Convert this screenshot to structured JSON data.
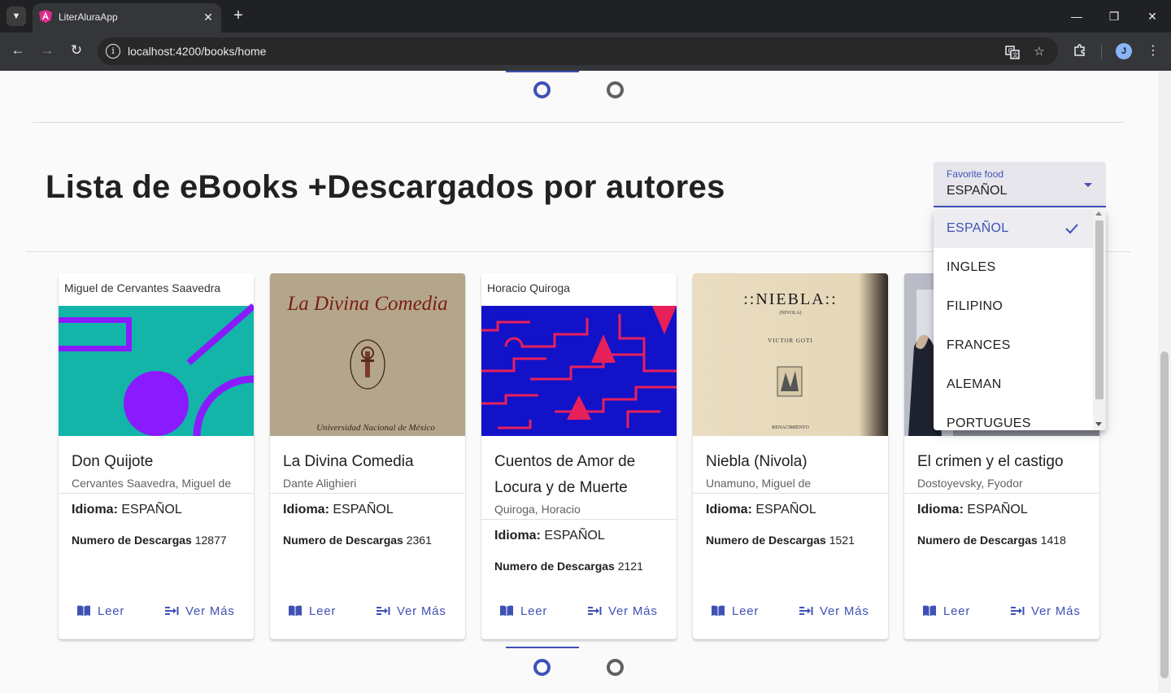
{
  "browser": {
    "tab_title": "LiterAluraApp",
    "url": "localhost:4200/books/home",
    "avatar_letter": "J",
    "favicon_color": "#dd2c8a"
  },
  "page": {
    "heading": "Lista de eBooks +Descargados por autores",
    "accent_color": "#3f51b5"
  },
  "select": {
    "label": "Favorite food",
    "value": "ESPAÑOL",
    "options": [
      "ESPAÑOL",
      "INGLES",
      "FILIPINO",
      "FRANCES",
      "ALEMAN",
      "PORTUGUES"
    ],
    "selected_index": 0
  },
  "carousel": {
    "slide_count": 2,
    "active_slide": 1
  },
  "books": [
    {
      "cover_text": "Miguel de Cervantes Saavedra",
      "title": "Don Quijote",
      "author": "Cervantes Saavedra, Miguel de",
      "language_label": "Idioma:",
      "language": "ESPAÑOL",
      "downloads_label": "Numero de Descargas",
      "downloads": "12877",
      "read_label": "Leer",
      "more_label": "Ver Más"
    },
    {
      "cover_text": "La Divina Comedia",
      "cover_subtext": "Universidad Nacional de México",
      "title": "La Divina Comedia",
      "author": "Dante Alighieri",
      "language_label": "Idioma:",
      "language": "ESPAÑOL",
      "downloads_label": "Numero de Descargas",
      "downloads": "2361",
      "read_label": "Leer",
      "more_label": "Ver Más"
    },
    {
      "cover_text": "Horacio Quiroga",
      "title": "Cuentos de Amor de Locura y de Muerte",
      "author": "Quiroga, Horacio",
      "language_label": "Idioma:",
      "language": "ESPAÑOL",
      "downloads_label": "Numero de Descargas",
      "downloads": "2121",
      "read_label": "Leer",
      "more_label": "Ver Más"
    },
    {
      "cover_text": "::NIEBLA::",
      "cover_subtext": "(NIVOLA)",
      "cover_author": "VICTOR GOTI",
      "cover_publisher": "RENACIMIENTO",
      "title": "Niebla (Nivola)",
      "author": "Unamuno, Miguel de",
      "language_label": "Idioma:",
      "language": "ESPAÑOL",
      "downloads_label": "Numero de Descargas",
      "downloads": "1521",
      "read_label": "Leer",
      "more_label": "Ver Más"
    },
    {
      "title": "El crimen y el castigo",
      "author": "Dostoyevsky, Fyodor",
      "language_label": "Idioma:",
      "language": "ESPAÑOL",
      "downloads_label": "Numero de Descargas",
      "downloads": "1418",
      "read_label": "Leer",
      "more_label": "Ver Más"
    }
  ]
}
